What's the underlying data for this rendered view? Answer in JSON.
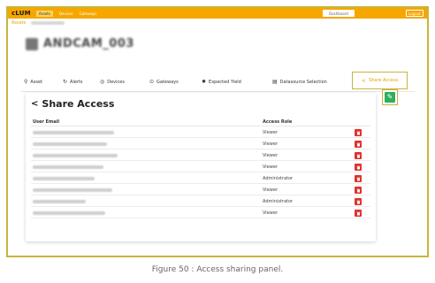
{
  "app": {
    "logo": "cLUM",
    "nav": [
      "Assets",
      "Devices",
      "Gateways"
    ],
    "dashboard_label": "Dashboard",
    "logout_label": "Logout"
  },
  "breadcrumb": {
    "root": "Assets"
  },
  "asset": {
    "title": "ANDCAM_003"
  },
  "tabs": [
    {
      "label": "Asset",
      "icon": "asset-icon"
    },
    {
      "label": "Alerts",
      "icon": "alerts-icon"
    },
    {
      "label": "Devices",
      "icon": "devices-icon"
    },
    {
      "label": "Gateways",
      "icon": "gateways-icon"
    },
    {
      "label": "Expected Yield",
      "icon": "sun-icon"
    },
    {
      "label": "Datasource Selection",
      "icon": "datasource-icon"
    },
    {
      "label": "Share Access",
      "icon": "share-icon",
      "active": true
    }
  ],
  "panel": {
    "title": "Share Access",
    "col_email": "User Email",
    "col_role": "Access Role",
    "rows": [
      {
        "role": "Viewer"
      },
      {
        "role": "Viewer"
      },
      {
        "role": "Viewer"
      },
      {
        "role": "Viewer"
      },
      {
        "role": "Administrator"
      },
      {
        "role": "Viewer"
      },
      {
        "role": "Administrator"
      },
      {
        "role": "Viewer"
      }
    ]
  },
  "colors": {
    "accent": "#f5a700",
    "highlight_border": "#c9b53a",
    "delete": "#e0302a",
    "edit": "#2eae5e"
  },
  "caption": "Figure 50 : Access sharing panel."
}
